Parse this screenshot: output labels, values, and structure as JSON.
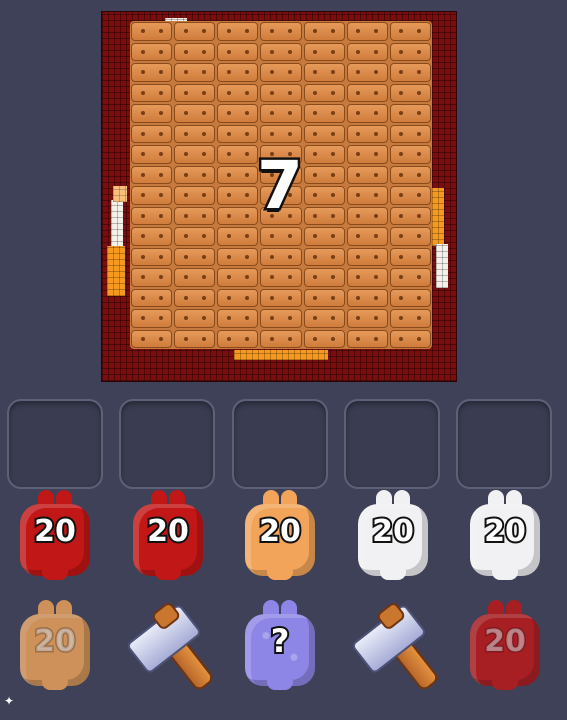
{
  "game": {
    "board": {
      "level_number": "7",
      "grid": {
        "columns": 7,
        "rows": 16
      },
      "colors": {
        "frame": "#7a0d0d",
        "crate": "#d98a48",
        "accent_white": "#f4f1ea",
        "accent_orange": "#f59a1e"
      }
    },
    "slots": {
      "count": 5,
      "filled": 0
    },
    "bins": {
      "row1": [
        {
          "color": "red",
          "count": "20"
        },
        {
          "color": "red",
          "count": "20"
        },
        {
          "color": "orange",
          "count": "20"
        },
        {
          "color": "white",
          "count": "20"
        },
        {
          "color": "white",
          "count": "20"
        }
      ],
      "row2": [
        {
          "color": "orange",
          "count": "20"
        },
        {
          "type": "hammer",
          "icon": "hammer-icon"
        },
        {
          "color": "mystery",
          "count": "?"
        },
        {
          "type": "hammer",
          "icon": "hammer-icon"
        },
        {
          "color": "red",
          "count": "20"
        }
      ]
    }
  }
}
